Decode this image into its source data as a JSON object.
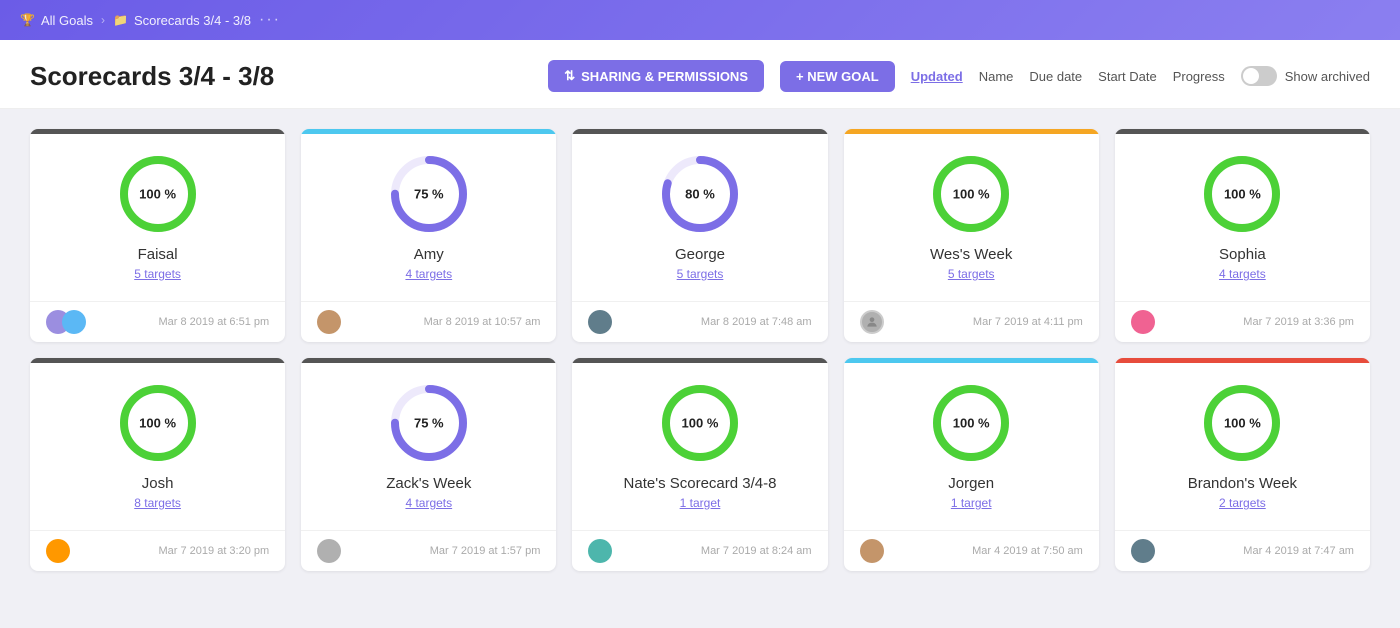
{
  "topbar": {
    "all_goals": "All Goals",
    "scorecard": "Scorecards 3/4 - 3/8",
    "trophy_icon": "🏆",
    "folder_icon": "📁"
  },
  "header": {
    "title": "Scorecards 3/4 - 3/8",
    "sharing_btn": "SHARING & PERMISSIONS",
    "new_goal_btn": "+ NEW GOAL",
    "sort_options": [
      "Updated",
      "Name",
      "Due date",
      "Start Date",
      "Progress"
    ],
    "active_sort": "Updated",
    "show_archived": "Show archived"
  },
  "cards": [
    {
      "id": "faisal",
      "name": "Faisal",
      "targets": "5 targets",
      "progress": 100,
      "progress_color": "#4cd137",
      "track_color": "#e8f8e8",
      "top_bar_color": "#555",
      "date": "Mar 8 2019 at 6:51 pm",
      "avatars": [
        "av-purple",
        "av-blue"
      ],
      "double_avatar": true
    },
    {
      "id": "amy",
      "name": "Amy",
      "targets": "4 targets",
      "progress": 75,
      "progress_color": "#7c6ee6",
      "track_color": "#ede9fb",
      "top_bar_color": "#4dc8ef",
      "date": "Mar 8 2019 at 10:57 am",
      "avatars": [
        "av-brown"
      ],
      "double_avatar": false
    },
    {
      "id": "george",
      "name": "George",
      "targets": "5 targets",
      "progress": 80,
      "progress_color": "#7c6ee6",
      "track_color": "#ede9fb",
      "top_bar_color": "#555",
      "date": "Mar 8 2019 at 7:48 am",
      "avatars": [
        "av-dark"
      ],
      "double_avatar": false
    },
    {
      "id": "wes-week",
      "name": "Wes's Week",
      "targets": "5 targets",
      "progress": 100,
      "progress_color": "#4cd137",
      "track_color": "#e8f8e8",
      "top_bar_color": "#f5a623",
      "date": "Mar 7 2019 at 4:11 pm",
      "avatars": [
        "av-gray"
      ],
      "double_avatar": false,
      "avatar_icon": "person"
    },
    {
      "id": "sophia",
      "name": "Sophia",
      "targets": "4 targets",
      "progress": 100,
      "progress_color": "#4cd137",
      "track_color": "#e8f8e8",
      "top_bar_color": "#555",
      "date": "Mar 7 2019 at 3:36 pm",
      "avatars": [
        "av-pink"
      ],
      "double_avatar": false
    },
    {
      "id": "josh",
      "name": "Josh",
      "targets": "8 targets",
      "progress": 100,
      "progress_color": "#4cd137",
      "track_color": "#e8f8e8",
      "top_bar_color": "#555",
      "date": "Mar 7 2019 at 3:20 pm",
      "avatars": [
        "av-orange"
      ],
      "double_avatar": false
    },
    {
      "id": "zacks-week",
      "name": "Zack's Week",
      "targets": "4 targets",
      "progress": 75,
      "progress_color": "#7c6ee6",
      "track_color": "#ede9fb",
      "top_bar_color": "#555",
      "date": "Mar 7 2019 at 1:57 pm",
      "avatars": [
        "av-gray"
      ],
      "double_avatar": false
    },
    {
      "id": "nate-scorecard",
      "name": "Nate's Scorecard 3/4-8",
      "targets": "1 target",
      "progress": 100,
      "progress_color": "#4cd137",
      "track_color": "#e8f8e8",
      "top_bar_color": "#555",
      "date": "Mar 7 2019 at 8:24 am",
      "avatars": [
        "av-teal"
      ],
      "double_avatar": false
    },
    {
      "id": "jorgen",
      "name": "Jorgen",
      "targets": "1 target",
      "progress": 100,
      "progress_color": "#4cd137",
      "track_color": "#e8f8e8",
      "top_bar_color": "#4dc8ef",
      "date": "Mar 4 2019 at 7:50 am",
      "avatars": [
        "av-brown"
      ],
      "double_avatar": false
    },
    {
      "id": "brandons-week",
      "name": "Brandon's Week",
      "targets": "2 targets",
      "progress": 100,
      "progress_color": "#4cd137",
      "track_color": "#e8f8e8",
      "top_bar_color": "#e74c3c",
      "date": "Mar 4 2019 at 7:47 am",
      "avatars": [
        "av-dark"
      ],
      "double_avatar": false
    }
  ]
}
